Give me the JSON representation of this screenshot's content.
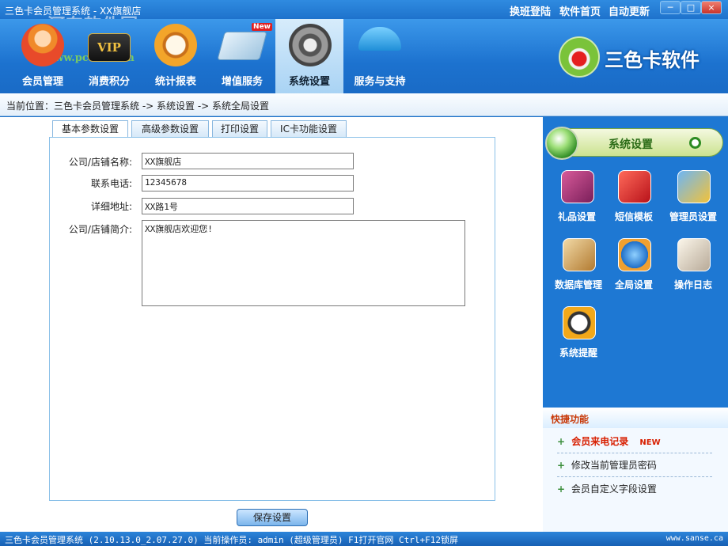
{
  "window": {
    "title": "三色卡会员管理系统 - XX旗舰店",
    "watermark": "河东软件园",
    "watermark_url": "www.pc0359.cn",
    "links": [
      "换班登陆",
      "软件首页",
      "自动更新"
    ],
    "controls": [
      "─",
      "□",
      "×"
    ]
  },
  "toolbar": {
    "items": [
      {
        "label": "会员管理",
        "icon": "members-icon",
        "color": "#f0a030"
      },
      {
        "label": "消费积分",
        "icon": "vip-card-icon",
        "color": "#2a2a2a",
        "badge": "VIP"
      },
      {
        "label": "统计报表",
        "icon": "clock-chart-icon",
        "color": "#e38b1a"
      },
      {
        "label": "增值服务",
        "icon": "money-cards-icon",
        "color": "#c9dcea",
        "badge_new": "New"
      },
      {
        "label": "系统设置",
        "icon": "gear-icon",
        "color": "#666666",
        "active": true
      },
      {
        "label": "服务与支持",
        "icon": "umbrella-icon",
        "color": "#47b6ef"
      }
    ],
    "brand": "三色卡软件"
  },
  "breadcrumb": "当前位置：三色卡会员管理系统 -> 系统设置 -> 系统全局设置",
  "tabs": [
    "基本参数设置",
    "高级参数设置",
    "打印设置",
    "IC卡功能设置"
  ],
  "form": {
    "company_label": "公司/店铺名称:",
    "company_value": "XX旗舰店",
    "phone_label": "联系电话:",
    "phone_value": "12345678",
    "address_label": "详细地址:",
    "address_value": "XX路1号",
    "intro_label": "公司/店铺简介:",
    "intro_value": "XX旗舰店欢迎您!",
    "save_label": "保存设置"
  },
  "sidebar": {
    "title": "系统设置",
    "items": [
      {
        "label": "礼品设置",
        "icon": "gift-icon",
        "color": "#b0307a"
      },
      {
        "label": "短信模板",
        "icon": "sms-template-icon",
        "color": "#d92a2a"
      },
      {
        "label": "管理员设置",
        "icon": "admin-key-icon",
        "color": "#e7a520"
      },
      {
        "label": "数据库管理",
        "icon": "database-icon",
        "color": "#c59244"
      },
      {
        "label": "全局设置",
        "icon": "globe-icon",
        "color": "#2f83d8"
      },
      {
        "label": "操作日志",
        "icon": "log-book-icon",
        "color": "#d8d0c4"
      },
      {
        "label": "系统提醒",
        "icon": "alarm-clock-icon",
        "color": "#f0a81a"
      }
    ]
  },
  "quick": {
    "title": "快捷功能",
    "items": [
      {
        "label": "会员来电记录",
        "new": "NEW"
      },
      {
        "label": "修改当前管理员密码"
      },
      {
        "label": "会员自定义字段设置"
      }
    ]
  },
  "status": {
    "text": "三色卡会员管理系统 (2.10.13.0_2.07.27.0)  当前操作员: admin (超级管理员)  F1打开官网 Ctrl+F12锁屏",
    "site": "www.sanse.ca"
  }
}
